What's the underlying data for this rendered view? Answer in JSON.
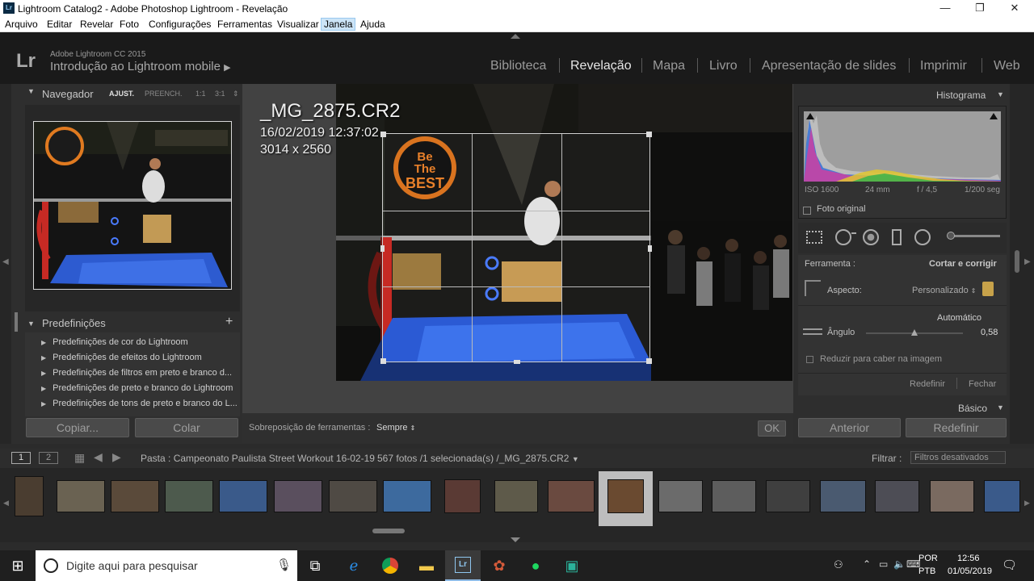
{
  "window": {
    "title": "Lightroom Catalog2 - Adobe Photoshop Lightroom - Revelação",
    "icon": "lightroom-app-icon",
    "minimize": "—",
    "maximize": "❐",
    "close": "✕"
  },
  "menu": [
    "Arquivo",
    "Editar",
    "Revelar",
    "Foto",
    "Configurações",
    "Ferramentas",
    "Visualizar",
    "Janela",
    "Ajuda"
  ],
  "menu_selected": "Janela",
  "header": {
    "logo": "Lr",
    "product": "Adobe Lightroom CC 2015",
    "identity": "Introdução ao Lightroom mobile",
    "identity_arrow": "▶",
    "modules": [
      "Biblioteca",
      "Revelação",
      "Mapa",
      "Livro",
      "Apresentação de slides",
      "Imprimir",
      "Web"
    ],
    "active_module": "Revelação"
  },
  "navigator": {
    "title": "Navegador",
    "options": [
      "AJUST.",
      "PREENCH.",
      "1:1",
      "3:1"
    ],
    "selected": "AJUST."
  },
  "presets": {
    "title": "Predefinições",
    "add": "+",
    "items": [
      "Predefinições de cor do Lightroom",
      "Predefinições de efeitos do Lightroom",
      "Predefinições de filtros em preto e branco d...",
      "Predefinições de preto e branco do Lightroom",
      "Predefinições de tons de preto e branco do L..."
    ]
  },
  "left_buttons": {
    "copy": "Copiar...",
    "paste": "Colar"
  },
  "photo": {
    "filename": "_MG_2875.CR2",
    "datetime": "16/02/2019 12:37:02",
    "dimensions": "3014 x 2560",
    "sign_text": [
      "Be",
      "The",
      "BEST"
    ]
  },
  "toolbar": {
    "overlay_label": "Sobreposição de ferramentas :",
    "overlay_value": "Sempre",
    "ok": "OK"
  },
  "histogram": {
    "title": "Histograma",
    "iso": "ISO 1600",
    "focal": "24 mm",
    "aperture": "f / 4,5",
    "shutter": "1/200 seg",
    "original_photo": "Foto original"
  },
  "crop": {
    "tool_label": "Ferramenta :",
    "tool_value": "Cortar e corrigir",
    "aspect_label": "Aspecto:",
    "aspect_value": "Personalizado",
    "auto": "Automático",
    "angle_label": "Ângulo",
    "angle_value": "0,58",
    "angle_fraction": 0.5,
    "constrain": "Reduzir para caber na imagem",
    "reset": "Redefinir",
    "close": "Fechar"
  },
  "basic_panel": "Básico",
  "right_buttons": {
    "previous": "Anterior",
    "reset": "Redefinir"
  },
  "filmstrip": {
    "view1": "1",
    "view2": "2",
    "folder": "Pasta : Campeonato Paulista Street Workout 16-02-19",
    "count": "567 fotos /1 selecionada(s) /_MG_2875.CR2",
    "filter_label": "Filtrar :",
    "filter_value": "Filtros desativados"
  },
  "taskbar": {
    "search_placeholder": "Digite aqui para pesquisar",
    "lang1": "POR",
    "lang2": "PTB",
    "time": "12:56",
    "date": "01/05/2019"
  },
  "colors": {
    "accent": "#e6e6e6",
    "panel": "#2e2e2e",
    "header": "#1a1a1a",
    "histogram_bg": "#9e9e9e"
  }
}
